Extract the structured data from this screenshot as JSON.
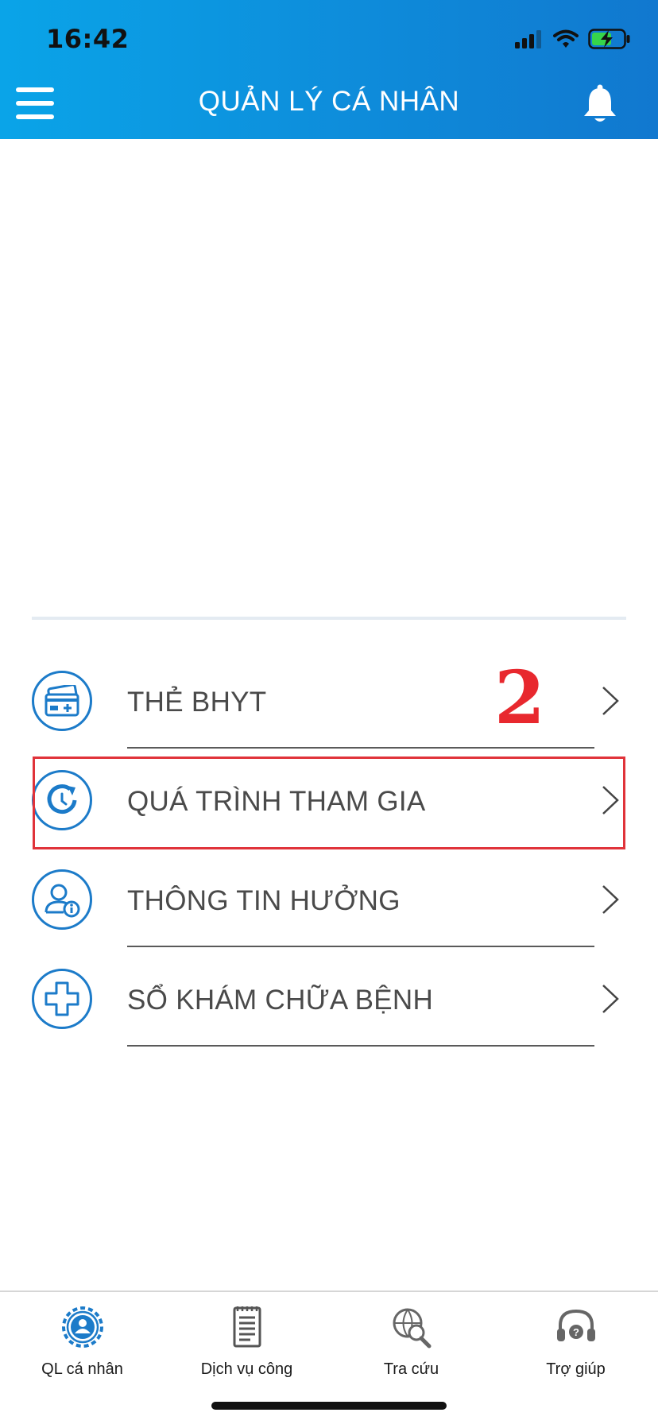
{
  "status_bar": {
    "time": "16:42"
  },
  "header": {
    "title": "QUẢN LÝ CÁ NHÂN"
  },
  "menu": {
    "items": [
      {
        "label": "THẺ BHYT",
        "icon": "health-card-icon"
      },
      {
        "label": "QUÁ TRÌNH THAM GIA",
        "icon": "history-clock-icon"
      },
      {
        "label": "THÔNG TIN HƯỞNG",
        "icon": "user-info-icon"
      },
      {
        "label": "SỔ KHÁM CHỮA BỆNH",
        "icon": "medical-cross-icon"
      }
    ]
  },
  "annotation": {
    "number": "2"
  },
  "tabbar": {
    "tabs": [
      {
        "label": "QL cá nhân",
        "icon": "personal-gear-icon"
      },
      {
        "label": "Dịch vụ công",
        "icon": "document-list-icon"
      },
      {
        "label": "Tra cứu",
        "icon": "globe-search-icon"
      },
      {
        "label": "Trợ giúp",
        "icon": "headset-help-icon"
      }
    ]
  },
  "colors": {
    "header_start": "#0aa4e8",
    "header_end": "#1178cf",
    "icon_blue": "#1c7bc9",
    "highlight_red": "#e0333a"
  }
}
